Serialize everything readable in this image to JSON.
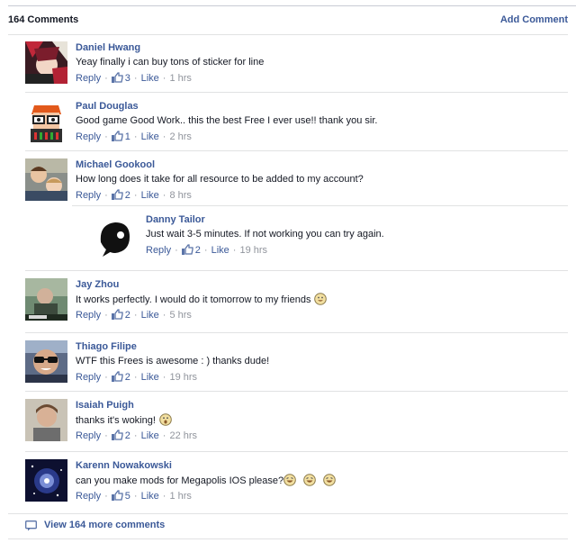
{
  "header": {
    "count_label": "164 Comments",
    "add_label": "Add Comment"
  },
  "actions": {
    "reply": "Reply",
    "like": "Like"
  },
  "comments": [
    {
      "name": "Daniel Hwang",
      "text": "Yeay finally i can buy tons of sticker for line",
      "likes": "3",
      "time": "1 hrs",
      "avatar_icon": "anime-avatar"
    },
    {
      "name": "Paul Douglas",
      "text": "Good game Good Work.. this the best Free I ever use!! thank you sir.",
      "likes": "1",
      "time": "2 hrs",
      "avatar_icon": "nerd-avatar"
    },
    {
      "name": "Michael Gookool",
      "text": "How long does it take for all resource to be added to my account?",
      "likes": "2",
      "time": "8 hrs",
      "avatar_icon": "family-photo-avatar"
    },
    {
      "name": "Jay Zhou",
      "text": "It works perfectly. I would do it tomorrow to my friends",
      "likes": "2",
      "time": "5 hrs",
      "avatar_icon": "photo-avatar",
      "emoji": [
        "smile-emoji"
      ]
    },
    {
      "name": "Thiago Filipe",
      "text": "WTF this Frees is awesome : ) thanks dude!",
      "likes": "2",
      "time": "19 hrs",
      "avatar_icon": "sunglasses-avatar"
    },
    {
      "name": "Isaiah Puigh",
      "text": "thanks it's woking!",
      "likes": "2",
      "time": "22 hrs",
      "avatar_icon": "portrait-avatar",
      "emoji": [
        "wow-emoji"
      ]
    },
    {
      "name": "Karenn Nowakowski",
      "text": "can you make mods for Megapolis IOS please?",
      "likes": "5",
      "time": "1 hrs",
      "avatar_icon": "galaxy-avatar",
      "emoji": [
        "laugh-emoji",
        "laugh-emoji",
        "laugh-emoji"
      ]
    }
  ],
  "reply": {
    "name": "Danny Tailor",
    "text": "Just wait 3-5 minutes. If not working you can try again.",
    "likes": "2",
    "time": "19 hrs",
    "avatar_icon": "silhouette-avatar"
  },
  "more_label": "View 164 more comments",
  "colors": {
    "link": "#3b5998",
    "meta": "#90949c",
    "rule": "#e1e2e3"
  }
}
